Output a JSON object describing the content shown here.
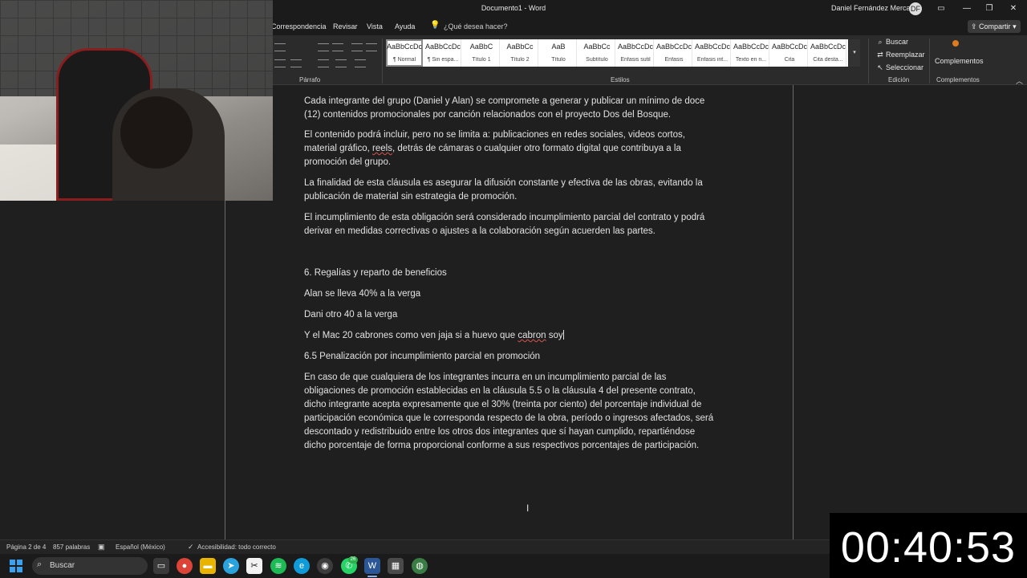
{
  "window": {
    "doc_title": "Documento1 - Word",
    "user_name": "Daniel Fernández Mercado",
    "user_initials": "DF",
    "controls": {
      "minimize": "—",
      "restore": "❐",
      "close": "✕"
    }
  },
  "menu": {
    "tabs": [
      "Correspondencia",
      "Revisar",
      "Vista",
      "Ayuda"
    ],
    "tell_me_placeholder": "¿Qué desea hacer?",
    "share_label": "Compartir"
  },
  "ribbon": {
    "groups": {
      "paragraph": "Párrafo",
      "styles": "Estilos",
      "editing": "Edición",
      "addins": "Complementos"
    },
    "styles": [
      {
        "sample": "AaBbCcDc",
        "name": "¶ Normal"
      },
      {
        "sample": "AaBbCcDc",
        "name": "¶ Sin espa..."
      },
      {
        "sample": "AaBbC",
        "name": "Título 1"
      },
      {
        "sample": "AaBbCc",
        "name": "Título 2"
      },
      {
        "sample": "AaB",
        "name": "Título"
      },
      {
        "sample": "AaBbCc",
        "name": "Subtítulo"
      },
      {
        "sample": "AaBbCcDc",
        "name": "Énfasis sutil"
      },
      {
        "sample": "AaBbCcDc",
        "name": "Énfasis"
      },
      {
        "sample": "AaBbCcDc",
        "name": "Énfasis int..."
      },
      {
        "sample": "AaBbCcDc",
        "name": "Texto en n..."
      },
      {
        "sample": "AaBbCcDc",
        "name": "Cita"
      },
      {
        "sample": "AaBbCcDc",
        "name": "Cita desta..."
      }
    ],
    "editing": {
      "find": "Buscar",
      "replace": "Reemplazar",
      "select": "Seleccionar"
    },
    "addins_button": "Complementos"
  },
  "document": {
    "paragraphs": {
      "p1": "Cada integrante del grupo (Daniel y Alan) se compromete a generar y publicar un mínimo de doce (12) contenidos promocionales por canción relacionados con el proyecto Dos del Bosque.",
      "p2_before": "El contenido podrá incluir, pero no se limita a: publicaciones en redes sociales, videos cortos, material gráfico, ",
      "p2_misspelled": "reels",
      "p2_after": ", detrás de cámaras o cualquier otro formato digital que contribuya a la promoción del grupo.",
      "p3": "La finalidad de esta cláusula es asegurar la difusión constante y efectiva de las obras, evitando la publicación de material sin estrategia de promoción.",
      "p4": "El incumplimiento de esta obligación será considerado incumplimiento parcial del contrato y podrá derivar en medidas correctivas o ajustes a la colaboración según acuerden las partes.",
      "h6": "6. Regalías y reparto de beneficios",
      "alan": "Alan se lleva 40% a la verga",
      "dani": "Dani otro 40 a la verga",
      "mac_before": "Y el Mac 20 cabrones como ven jaja si a huevo que ",
      "mac_misspelled": "cabron",
      "mac_after": " soy",
      "h65": "6.5 Penalización por incumplimiento parcial en promoción",
      "p_last": "En caso de que cualquiera de los integrantes incurra en un incumplimiento parcial de las obligaciones de promoción establecidas en la cláusula 5.5 o la cláusula 4 del presente contrato, dicho integrante acepta expresamente que el 30% (treinta por ciento) del porcentaje individual de participación económica que le corresponda respecto de la obra, período o ingresos afectados, será descontado y redistribuido entre los otros dos integrantes que sí hayan cumplido, repartiéndose dicho porcentaje de forma proporcional conforme a sus respectivos porcentajes de participación."
    }
  },
  "status": {
    "page": "Página 2 de 4",
    "words": "857 palabras",
    "language": "Español (México)",
    "accessibility": "Accesibilidad: todo correcto"
  },
  "taskbar": {
    "search_placeholder": "Buscar",
    "whatsapp_badge": "26"
  },
  "timer": "00:40:53",
  "colors": {
    "accent_blue": "#3aa0f0",
    "spell_error": "#d9534f",
    "addins_orange": "#e07a1f"
  }
}
